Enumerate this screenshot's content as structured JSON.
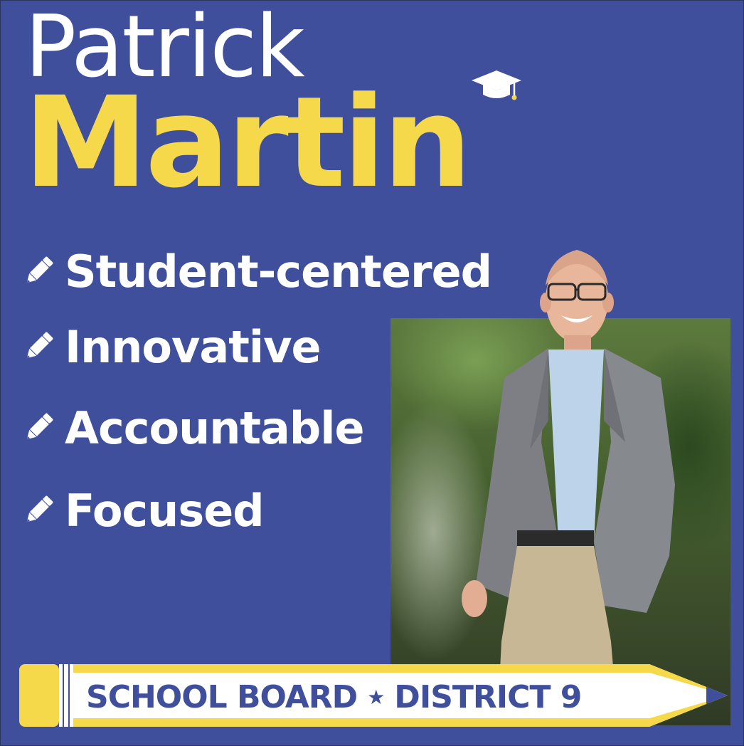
{
  "candidate": {
    "first_name": "Patrick",
    "last_name": "Martin"
  },
  "values": [
    "Student-centered",
    "Innovative",
    "Accountable",
    "Focused"
  ],
  "banner": {
    "office": "SCHOOL BOARD",
    "separator": "★",
    "district": "DISTRICT 9"
  },
  "colors": {
    "background": "#3f4f9c",
    "accent_yellow": "#f6d94a",
    "text_white": "#ffffff"
  },
  "icons": {
    "bullet": "pencil-icon",
    "title_decoration": "graduation-cap-icon",
    "banner_shape": "pencil"
  }
}
